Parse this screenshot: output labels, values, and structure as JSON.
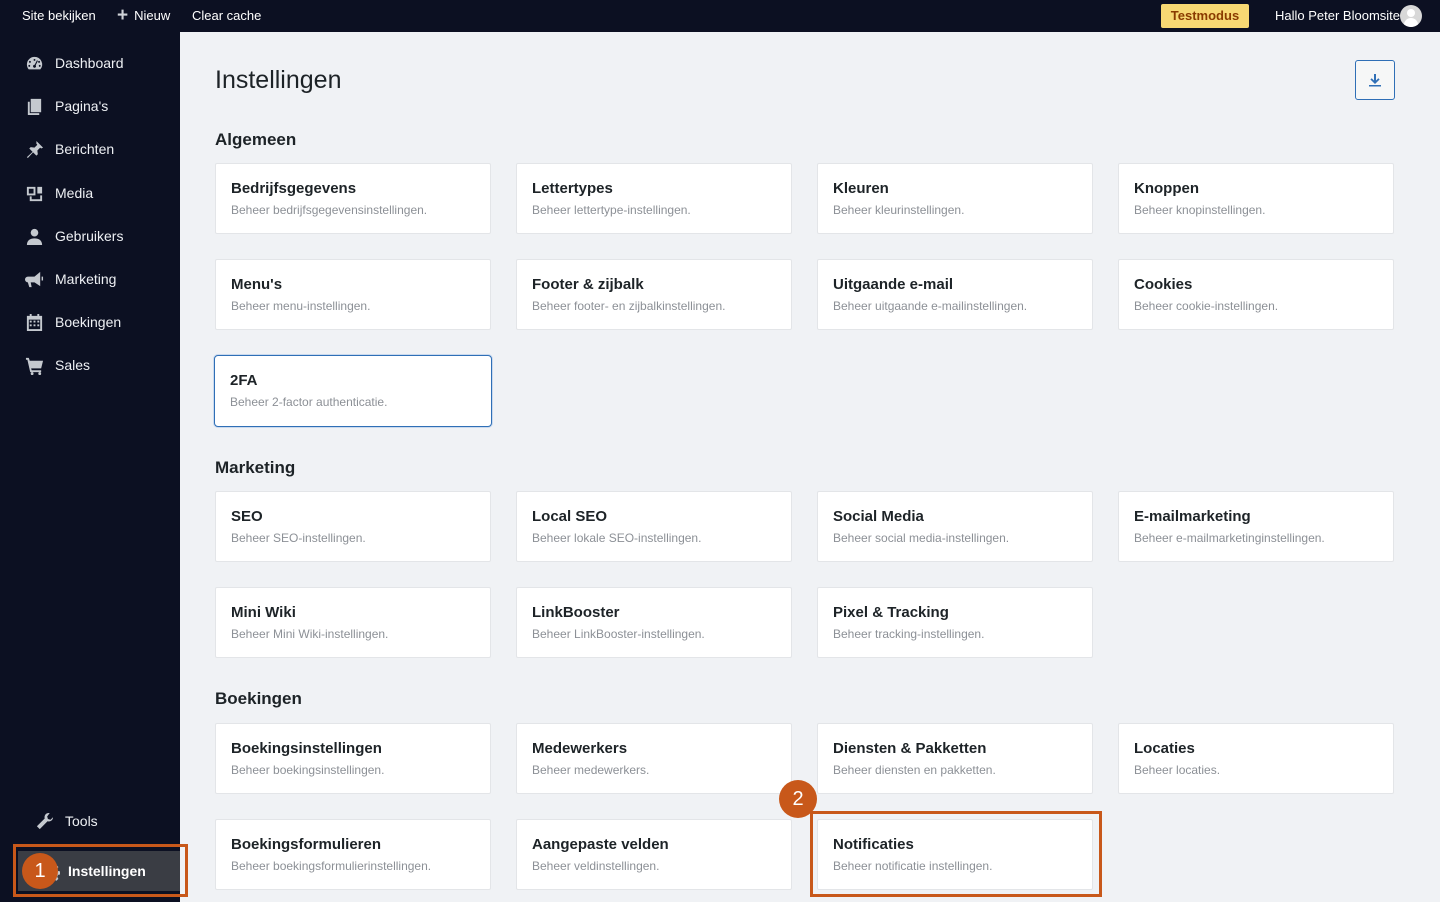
{
  "topbar": {
    "site_label": "Site bekijken",
    "new_label": "Nieuw",
    "clear_label": "Clear cache",
    "badge": "Testmodus",
    "greeting": "Hallo Peter Bloomsite"
  },
  "sidebar": {
    "items": [
      {
        "label": "Dashboard",
        "icon": "dashboard-icon"
      },
      {
        "label": "Pagina's",
        "icon": "pages-icon"
      },
      {
        "label": "Berichten",
        "icon": "pin-icon"
      },
      {
        "label": "Media",
        "icon": "media-icon"
      },
      {
        "label": "Gebruikers",
        "icon": "user-icon"
      },
      {
        "label": "Marketing",
        "icon": "megaphone-icon"
      },
      {
        "label": "Boekingen",
        "icon": "calendar-icon"
      },
      {
        "label": "Sales",
        "icon": "cart-icon"
      }
    ],
    "tools": "Tools",
    "settings": "Instellingen"
  },
  "annotations": {
    "step1": "1",
    "step2": "2",
    "accent": "#c8581a"
  },
  "main": {
    "title": "Instellingen",
    "sections": [
      {
        "heading": "Algemeen",
        "cards": [
          {
            "title": "Bedrijfsgegevens",
            "desc": "Beheer bedrijfsgegevensinstellingen."
          },
          {
            "title": "Lettertypes",
            "desc": "Beheer lettertype-instellingen."
          },
          {
            "title": "Kleuren",
            "desc": "Beheer kleurinstellingen."
          },
          {
            "title": "Knoppen",
            "desc": "Beheer knopinstellingen."
          },
          {
            "title": "Menu's",
            "desc": "Beheer menu-instellingen."
          },
          {
            "title": "Footer & zijbalk",
            "desc": "Beheer footer- en zijbalkinstellingen."
          },
          {
            "title": "Uitgaande e-mail",
            "desc": "Beheer uitgaande e-mailinstellingen."
          },
          {
            "title": "Cookies",
            "desc": "Beheer cookie-instellingen."
          },
          {
            "title": "2FA",
            "desc": "Beheer 2-factor authenticatie."
          }
        ]
      },
      {
        "heading": "Marketing",
        "cards": [
          {
            "title": "SEO",
            "desc": "Beheer SEO-instellingen."
          },
          {
            "title": "Local SEO",
            "desc": "Beheer lokale SEO-instellingen."
          },
          {
            "title": "Social Media",
            "desc": "Beheer social media-instellingen."
          },
          {
            "title": "E-mailmarketing",
            "desc": "Beheer e-mailmarketinginstellingen."
          },
          {
            "title": "Mini Wiki",
            "desc": "Beheer Mini Wiki-instellingen."
          },
          {
            "title": "LinkBooster",
            "desc": "Beheer LinkBooster-instellingen."
          },
          {
            "title": "Pixel & Tracking",
            "desc": "Beheer tracking-instellingen."
          }
        ]
      },
      {
        "heading": "Boekingen",
        "cards": [
          {
            "title": "Boekingsinstellingen",
            "desc": "Beheer boekingsinstellingen."
          },
          {
            "title": "Medewerkers",
            "desc": "Beheer medewerkers."
          },
          {
            "title": "Diensten & Pakketten",
            "desc": "Beheer diensten en pakketten."
          },
          {
            "title": "Locaties",
            "desc": "Beheer locaties."
          },
          {
            "title": "Boekingsformulieren",
            "desc": "Beheer boekingsformulierinstellingen."
          },
          {
            "title": "Aangepaste velden",
            "desc": "Beheer veldinstellingen."
          },
          {
            "title": "Notificaties",
            "desc": "Beheer notificatie instellingen."
          }
        ]
      }
    ]
  }
}
